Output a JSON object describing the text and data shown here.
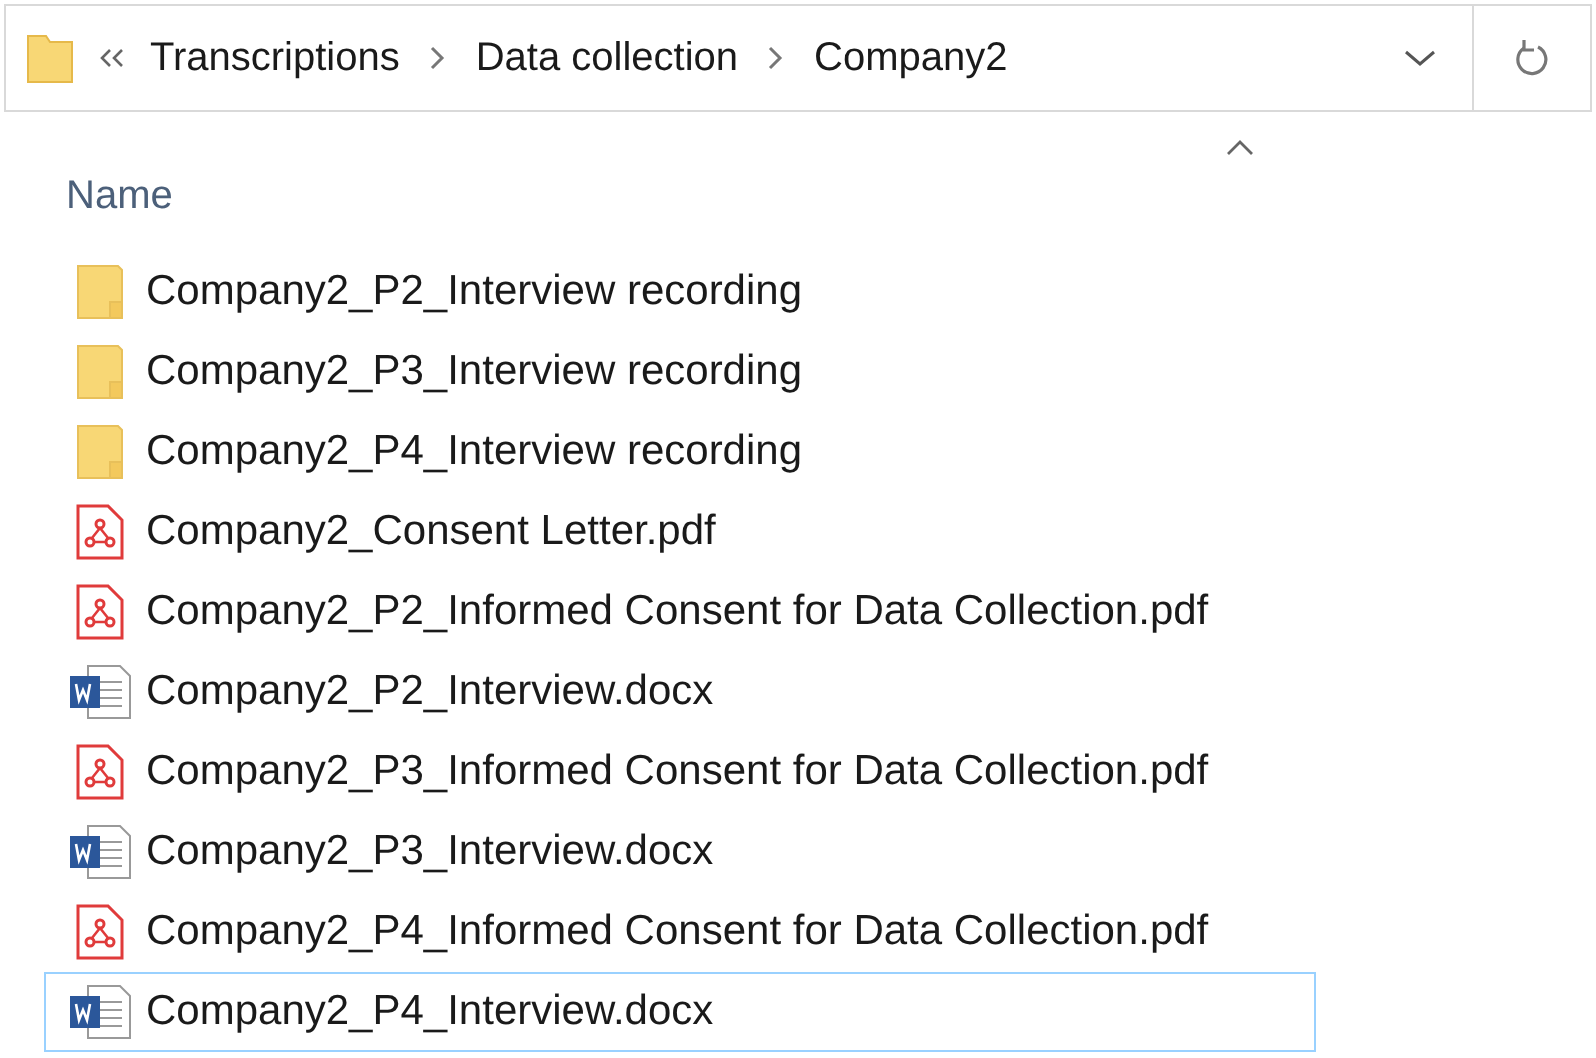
{
  "address_bar": {
    "breadcrumbs": [
      "Transcriptions",
      "Data collection",
      "Company2"
    ]
  },
  "column_header": {
    "label": "Name"
  },
  "files": [
    {
      "kind": "folder",
      "name": "Company2_P2_Interview recording",
      "focused": false
    },
    {
      "kind": "folder",
      "name": "Company2_P3_Interview recording",
      "focused": false
    },
    {
      "kind": "folder",
      "name": "Company2_P4_Interview recording",
      "focused": false
    },
    {
      "kind": "pdf",
      "name": "Company2_Consent Letter.pdf",
      "focused": false
    },
    {
      "kind": "pdf",
      "name": "Company2_P2_Informed Consent for Data Collection.pdf",
      "focused": false
    },
    {
      "kind": "docx",
      "name": "Company2_P2_Interview.docx",
      "focused": false
    },
    {
      "kind": "pdf",
      "name": "Company2_P3_Informed Consent for Data Collection.pdf",
      "focused": false
    },
    {
      "kind": "docx",
      "name": "Company2_P3_Interview.docx",
      "focused": false
    },
    {
      "kind": "pdf",
      "name": "Company2_P4_Informed Consent for Data Collection.pdf",
      "focused": false
    },
    {
      "kind": "docx",
      "name": "Company2_P4_Interview.docx",
      "focused": true
    }
  ]
}
